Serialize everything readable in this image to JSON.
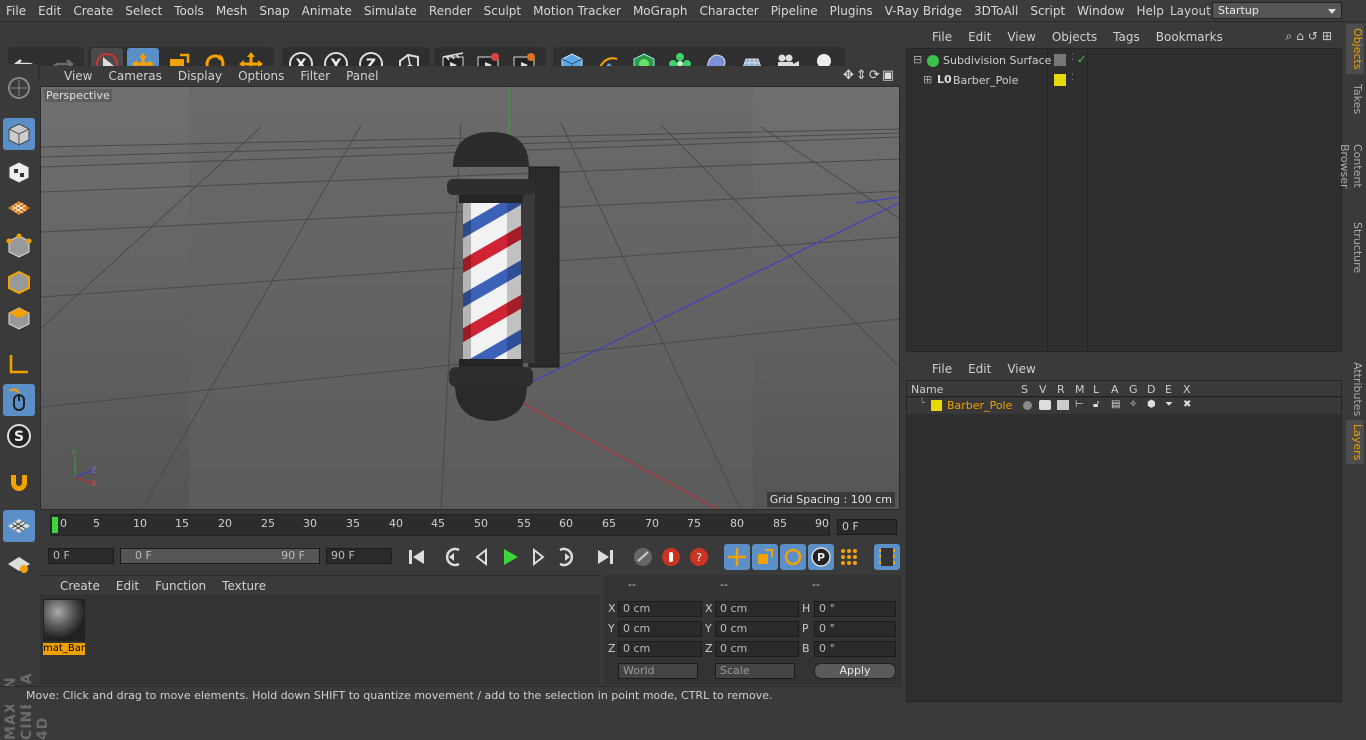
{
  "menubar": {
    "items": [
      "File",
      "Edit",
      "Create",
      "Select",
      "Tools",
      "Mesh",
      "Snap",
      "Animate",
      "Simulate",
      "Render",
      "Sculpt",
      "Motion Tracker",
      "MoGraph",
      "Character",
      "Pipeline",
      "Plugins",
      "V-Ray Bridge",
      "3DToAll",
      "Script",
      "Window",
      "Help"
    ],
    "layout_label": "Layout:",
    "layout_value": "Startup"
  },
  "viewport": {
    "menu": [
      "View",
      "Cameras",
      "Display",
      "Options",
      "Filter",
      "Panel"
    ],
    "label": "Perspective",
    "grid_spacing": "Grid Spacing : 100 cm"
  },
  "timeline": {
    "ticks": [
      "0",
      "5",
      "10",
      "15",
      "20",
      "25",
      "30",
      "35",
      "40",
      "45",
      "50",
      "55",
      "60",
      "65",
      "70",
      "75",
      "80",
      "85",
      "90"
    ],
    "current_frame": "0 F"
  },
  "transport": {
    "start": "0 F",
    "range_start": "0 F",
    "range_end": "90 F",
    "end": "90 F"
  },
  "materials": {
    "menu": [
      "Create",
      "Edit",
      "Function",
      "Texture"
    ],
    "item": "mat_Bar"
  },
  "coords": {
    "headers": [
      "--",
      "--",
      "--"
    ],
    "x": "0 cm",
    "y": "0 cm",
    "z": "0 cm",
    "sx": "0 cm",
    "sy": "0 cm",
    "sz": "0 cm",
    "h": "0 °",
    "p": "0 °",
    "b": "0 °",
    "labels": [
      "X",
      "Y",
      "Z",
      "X",
      "Y",
      "Z",
      "H",
      "P",
      "B"
    ],
    "world": "World",
    "scale": "Scale",
    "apply": "Apply"
  },
  "status": "Move: Click and drag to move elements. Hold down SHIFT to quantize movement / add to the selection in point mode, CTRL to remove.",
  "objects": {
    "menu": [
      "File",
      "Edit",
      "View",
      "Objects",
      "Tags",
      "Bookmarks"
    ],
    "items": [
      "Subdivision Surface",
      "Barber_Pole"
    ],
    "layer_color": "#e6d800"
  },
  "layers": {
    "menu": [
      "File",
      "Edit",
      "View"
    ],
    "headers": [
      "Name",
      "S",
      "V",
      "R",
      "M",
      "L",
      "A",
      "G",
      "D",
      "E",
      "X"
    ],
    "item": "Barber_Pole",
    "item_color": "#e6d800"
  },
  "right_tabs": [
    "Objects",
    "Takes",
    "Content Browser",
    "Structure",
    "Attributes",
    "Layers"
  ],
  "colors": {
    "accent": "#f0a000",
    "selected_tool": "#5a8fc8"
  }
}
